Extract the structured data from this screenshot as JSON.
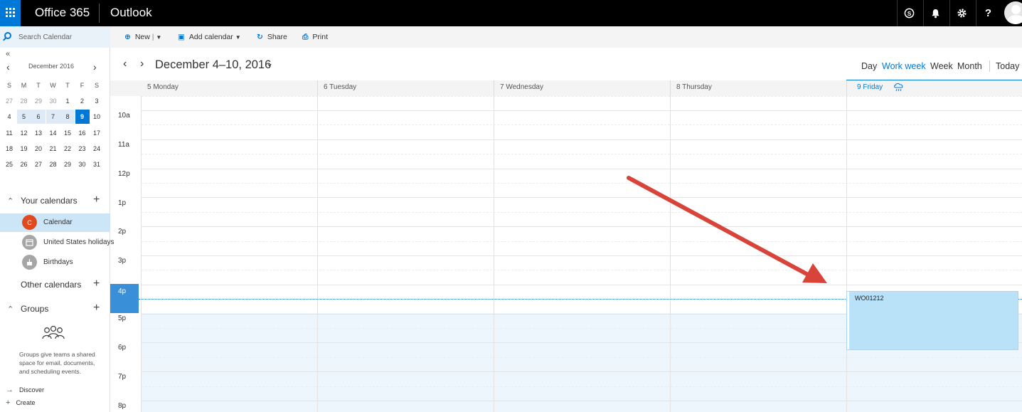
{
  "topbar": {
    "suite_name": "Office 365",
    "app_name": "Outlook",
    "icons": [
      "skype-icon",
      "bell-icon",
      "gear-icon",
      "help-icon"
    ]
  },
  "search": {
    "placeholder": "Search Calendar"
  },
  "mini_calendar": {
    "month_label": "December 2016",
    "weekday_headers": [
      "S",
      "M",
      "T",
      "W",
      "T",
      "F",
      "S"
    ],
    "weeks": [
      [
        "27",
        "28",
        "29",
        "30",
        "1",
        "2",
        "3"
      ],
      [
        "4",
        "5",
        "6",
        "7",
        "8",
        "9",
        "10"
      ],
      [
        "11",
        "12",
        "13",
        "14",
        "15",
        "16",
        "17"
      ],
      [
        "18",
        "19",
        "20",
        "21",
        "22",
        "23",
        "24"
      ],
      [
        "25",
        "26",
        "27",
        "28",
        "29",
        "30",
        "31"
      ]
    ],
    "today": "9"
  },
  "sidebar": {
    "your_calendars": "Your calendars",
    "calendars": [
      {
        "initial": "C",
        "label": "Calendar",
        "color": "#e04a1f"
      },
      {
        "initial": "",
        "label": "United States holidays",
        "color": "#a6a6a6"
      },
      {
        "initial": "",
        "label": "Birthdays",
        "color": "#a6a6a6"
      }
    ],
    "other_calendars": "Other calendars",
    "groups": "Groups",
    "groups_description": "Groups give teams a shared space for email, documents, and scheduling events.",
    "discover": "Discover",
    "create": "Create"
  },
  "commands": {
    "new": "New",
    "add_calendar": "Add calendar",
    "share": "Share",
    "print": "Print"
  },
  "header": {
    "range": "December 4–10, 2016",
    "views": [
      "Day",
      "Work week",
      "Week",
      "Month"
    ],
    "active_view": "Work week",
    "today": "Today"
  },
  "days": [
    "5 Monday",
    "6 Tuesday",
    "7 Wednesday",
    "8 Thursday",
    "9 Friday"
  ],
  "today_column": "9 Friday",
  "hours": [
    "10a",
    "11a",
    "12p",
    "1p",
    "2p",
    "3p",
    "4p",
    "5p",
    "6p",
    "7p",
    "8p"
  ],
  "current_hour": "4p",
  "event": {
    "title": "WO01212",
    "day": "9 Friday",
    "color": "#b9e2f9"
  },
  "colors": {
    "accent": "#0078d7",
    "annotation_arrow": "#d9443a"
  }
}
